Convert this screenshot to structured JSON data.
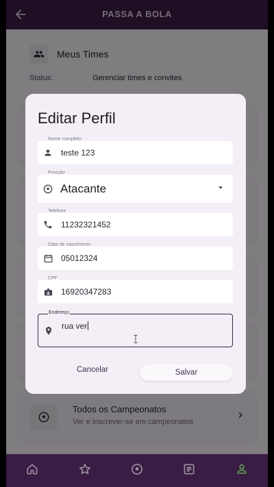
{
  "appbar": {
    "title": "PASSA A BOLA",
    "back_icon": "arrow-back-icon"
  },
  "teams": {
    "label": "Meus Times",
    "status_label": "Status:",
    "status_value": "Gerenciar times e convites"
  },
  "campeonatos": {
    "title": "Todos os Campeonatos",
    "subtitle": "Ver e inscrever-se em campeonatos"
  },
  "dialog": {
    "title": "Editar Perfil",
    "fields": {
      "name": {
        "label": "Nome completo",
        "value": "teste 123",
        "icon": "person-icon"
      },
      "position": {
        "label": "Posição",
        "value": "Atacante",
        "icon": "soccer-ball-icon"
      },
      "phone": {
        "label": "Telefone",
        "value": "11232321452",
        "icon": "phone-icon"
      },
      "birthdate": {
        "label": "Data de nascimento",
        "value": "05012324",
        "icon": "calendar-icon"
      },
      "cpf": {
        "label": "CPF",
        "value": "16920347283",
        "icon": "id-badge-icon"
      },
      "address": {
        "label": "Endereço",
        "value": "rua ver",
        "icon": "location-pin-icon"
      }
    },
    "cancel_label": "Cancelar",
    "save_label": "Salvar"
  },
  "navbar": {
    "items": [
      {
        "name": "home-icon"
      },
      {
        "name": "star-icon"
      },
      {
        "name": "soccer-ball-icon"
      },
      {
        "name": "article-icon"
      },
      {
        "name": "person-settings-icon",
        "active": true
      }
    ]
  },
  "colors": {
    "appbar": "#3b1c44",
    "dialog": "#f4eef6",
    "accent": "#5c9a55"
  }
}
